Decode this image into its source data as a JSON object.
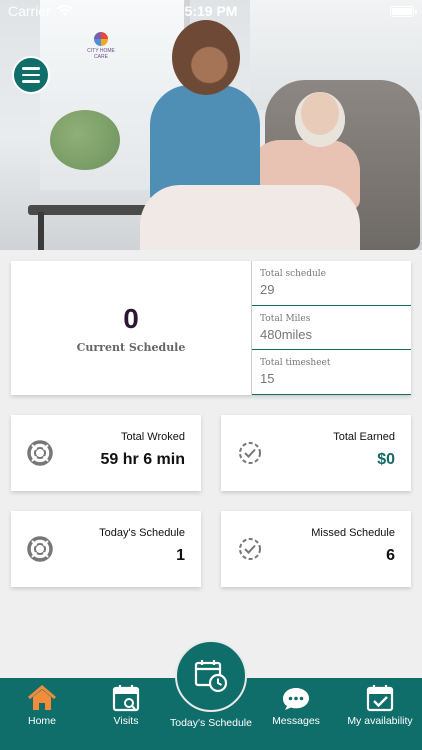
{
  "status_bar": {
    "carrier": "Carrier",
    "time": "5:19 PM"
  },
  "hero": {
    "logo_text": "CITY HOME CARE"
  },
  "summary": {
    "current_schedule_count": "0",
    "current_schedule_label": "Current Schedule",
    "stats": [
      {
        "label": "Total schedule",
        "value": "29"
      },
      {
        "label": "Total Miles",
        "value": "480miles"
      },
      {
        "label": "Total timesheet",
        "value": "15"
      }
    ]
  },
  "tiles": {
    "total_worked": {
      "label": "Total Wroked",
      "value": "59 hr 6 min"
    },
    "total_earned": {
      "label": "Total Earned",
      "value": "$0"
    },
    "todays_schedule": {
      "label": "Today's Schedule",
      "value": "1"
    },
    "missed_schedule": {
      "label": "Missed Schedule",
      "value": "6"
    }
  },
  "bottom_nav": {
    "home": "Home",
    "visits": "Visits",
    "todays_schedule": "Today's Schedule",
    "messages": "Messages",
    "availability": "My availability"
  },
  "colors": {
    "primary": "#0f6e6a",
    "home_icon": "#f28c3a",
    "earned": "#136b64"
  }
}
